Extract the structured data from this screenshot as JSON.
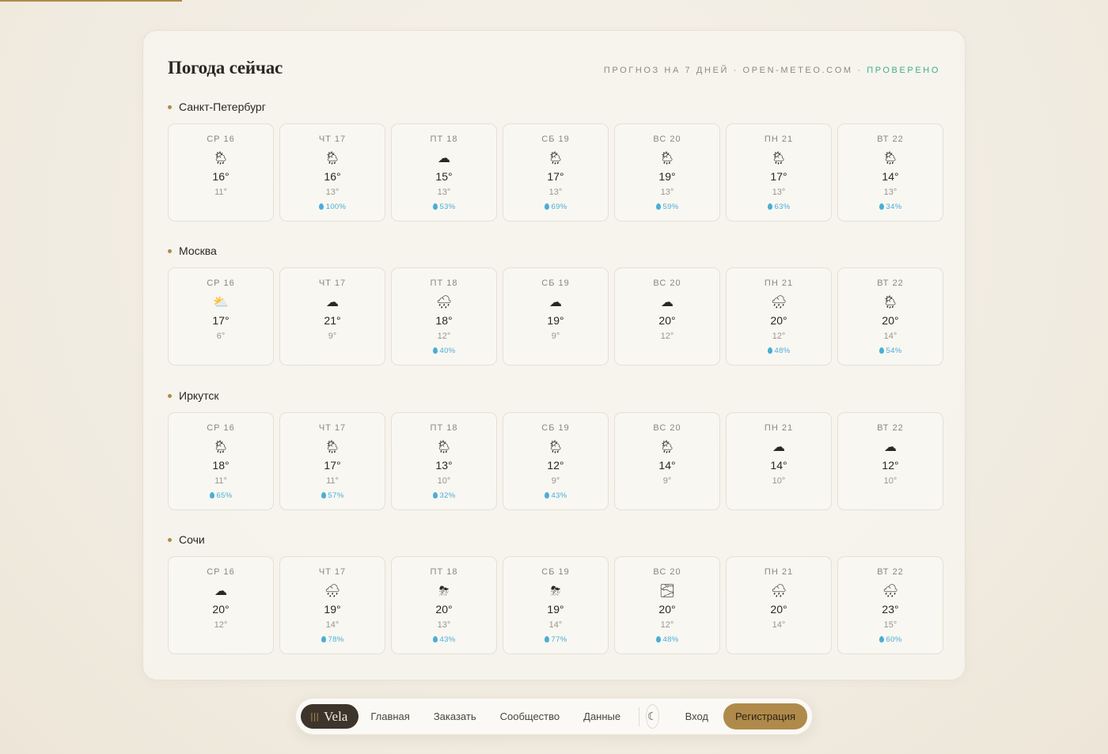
{
  "page": {
    "title": "Погода сейчас",
    "subtitle_main": "ПРОГНОЗ НА 7 ДНЕЙ · OPEN-METEO.COM · ",
    "subtitle_verified": "ПРОВЕРЕНО"
  },
  "cities": [
    {
      "name": "Санкт-Петербург",
      "days": [
        {
          "label": "СР 16",
          "icon": "🌦",
          "icon_name": "sun-rain-icon",
          "high": "16°",
          "low": "11°",
          "rain": ""
        },
        {
          "label": "ЧТ 17",
          "icon": "🌦",
          "icon_name": "sun-rain-icon",
          "high": "16°",
          "low": "13°",
          "rain": "100%"
        },
        {
          "label": "ПТ 18",
          "icon": "☁",
          "icon_name": "cloud-icon",
          "high": "15°",
          "low": "13°",
          "rain": "53%"
        },
        {
          "label": "СБ 19",
          "icon": "🌦",
          "icon_name": "sun-rain-icon",
          "high": "17°",
          "low": "13°",
          "rain": "69%"
        },
        {
          "label": "ВС 20",
          "icon": "🌦",
          "icon_name": "sun-rain-icon",
          "high": "19°",
          "low": "13°",
          "rain": "59%"
        },
        {
          "label": "ПН 21",
          "icon": "🌦",
          "icon_name": "sun-rain-icon",
          "high": "17°",
          "low": "13°",
          "rain": "63%"
        },
        {
          "label": "ВТ 22",
          "icon": "🌦",
          "icon_name": "sun-rain-icon",
          "high": "14°",
          "low": "13°",
          "rain": "34%"
        }
      ]
    },
    {
      "name": "Москва",
      "days": [
        {
          "label": "СР 16",
          "icon": "⛅",
          "icon_name": "partly-cloudy-icon",
          "high": "17°",
          "low": "6°",
          "rain": ""
        },
        {
          "label": "ЧТ 17",
          "icon": "☁",
          "icon_name": "cloud-icon",
          "high": "21°",
          "low": "9°",
          "rain": ""
        },
        {
          "label": "ПТ 18",
          "icon": "🌧",
          "icon_name": "rain-icon",
          "high": "18°",
          "low": "12°",
          "rain": "40%"
        },
        {
          "label": "СБ 19",
          "icon": "☁",
          "icon_name": "cloud-icon",
          "high": "19°",
          "low": "9°",
          "rain": ""
        },
        {
          "label": "ВС 20",
          "icon": "☁",
          "icon_name": "cloud-icon",
          "high": "20°",
          "low": "12°",
          "rain": ""
        },
        {
          "label": "ПН 21",
          "icon": "🌧",
          "icon_name": "rain-icon",
          "high": "20°",
          "low": "12°",
          "rain": "48%"
        },
        {
          "label": "ВТ 22",
          "icon": "🌦",
          "icon_name": "sun-rain-icon",
          "high": "20°",
          "low": "14°",
          "rain": "54%"
        }
      ]
    },
    {
      "name": "Иркутск",
      "days": [
        {
          "label": "СР 16",
          "icon": "🌦",
          "icon_name": "sun-rain-icon",
          "high": "18°",
          "low": "11°",
          "rain": "65%"
        },
        {
          "label": "ЧТ 17",
          "icon": "🌦",
          "icon_name": "sun-rain-icon",
          "high": "17°",
          "low": "11°",
          "rain": "57%"
        },
        {
          "label": "ПТ 18",
          "icon": "🌦",
          "icon_name": "sun-rain-icon",
          "high": "13°",
          "low": "10°",
          "rain": "32%"
        },
        {
          "label": "СБ 19",
          "icon": "🌦",
          "icon_name": "sun-rain-icon",
          "high": "12°",
          "low": "9°",
          "rain": "43%"
        },
        {
          "label": "ВС 20",
          "icon": "🌦",
          "icon_name": "sun-rain-icon",
          "high": "14°",
          "low": "9°",
          "rain": ""
        },
        {
          "label": "ПН 21",
          "icon": "☁",
          "icon_name": "cloud-icon",
          "high": "14°",
          "low": "10°",
          "rain": ""
        },
        {
          "label": "ВТ 22",
          "icon": "☁",
          "icon_name": "cloud-icon",
          "high": "12°",
          "low": "10°",
          "rain": ""
        }
      ]
    },
    {
      "name": "Сочи",
      "days": [
        {
          "label": "СР 16",
          "icon": "☁",
          "icon_name": "cloud-icon",
          "high": "20°",
          "low": "12°",
          "rain": ""
        },
        {
          "label": "ЧТ 17",
          "icon": "🌧",
          "icon_name": "rain-icon",
          "high": "19°",
          "low": "14°",
          "rain": "78%"
        },
        {
          "label": "ПТ 18",
          "icon": "⛈",
          "icon_name": "thunderstorm-icon",
          "high": "20°",
          "low": "13°",
          "rain": "43%"
        },
        {
          "label": "СБ 19",
          "icon": "⛈",
          "icon_name": "thunderstorm-icon",
          "high": "19°",
          "low": "14°",
          "rain": "77%"
        },
        {
          "label": "ВС 20",
          "icon": "🌫",
          "icon_name": "fog-icon",
          "high": "20°",
          "low": "12°",
          "rain": "48%"
        },
        {
          "label": "ПН 21",
          "icon": "🌧",
          "icon_name": "rain-icon",
          "high": "20°",
          "low": "14°",
          "rain": ""
        },
        {
          "label": "ВТ 22",
          "icon": "🌧",
          "icon_name": "rain-icon",
          "high": "23°",
          "low": "15°",
          "rain": "60%"
        }
      ]
    }
  ],
  "nav": {
    "brand": "Vela",
    "brand_mark": "|||",
    "links": [
      "Главная",
      "Заказать",
      "Сообщество",
      "Данные"
    ],
    "theme_icon": "☾",
    "login": "Вход",
    "register": "Регистрация"
  },
  "colors": {
    "accent": "#b08a4a",
    "verified": "#3fae8a",
    "rain": "#4aaed6",
    "brand_bg": "#3d342b"
  }
}
